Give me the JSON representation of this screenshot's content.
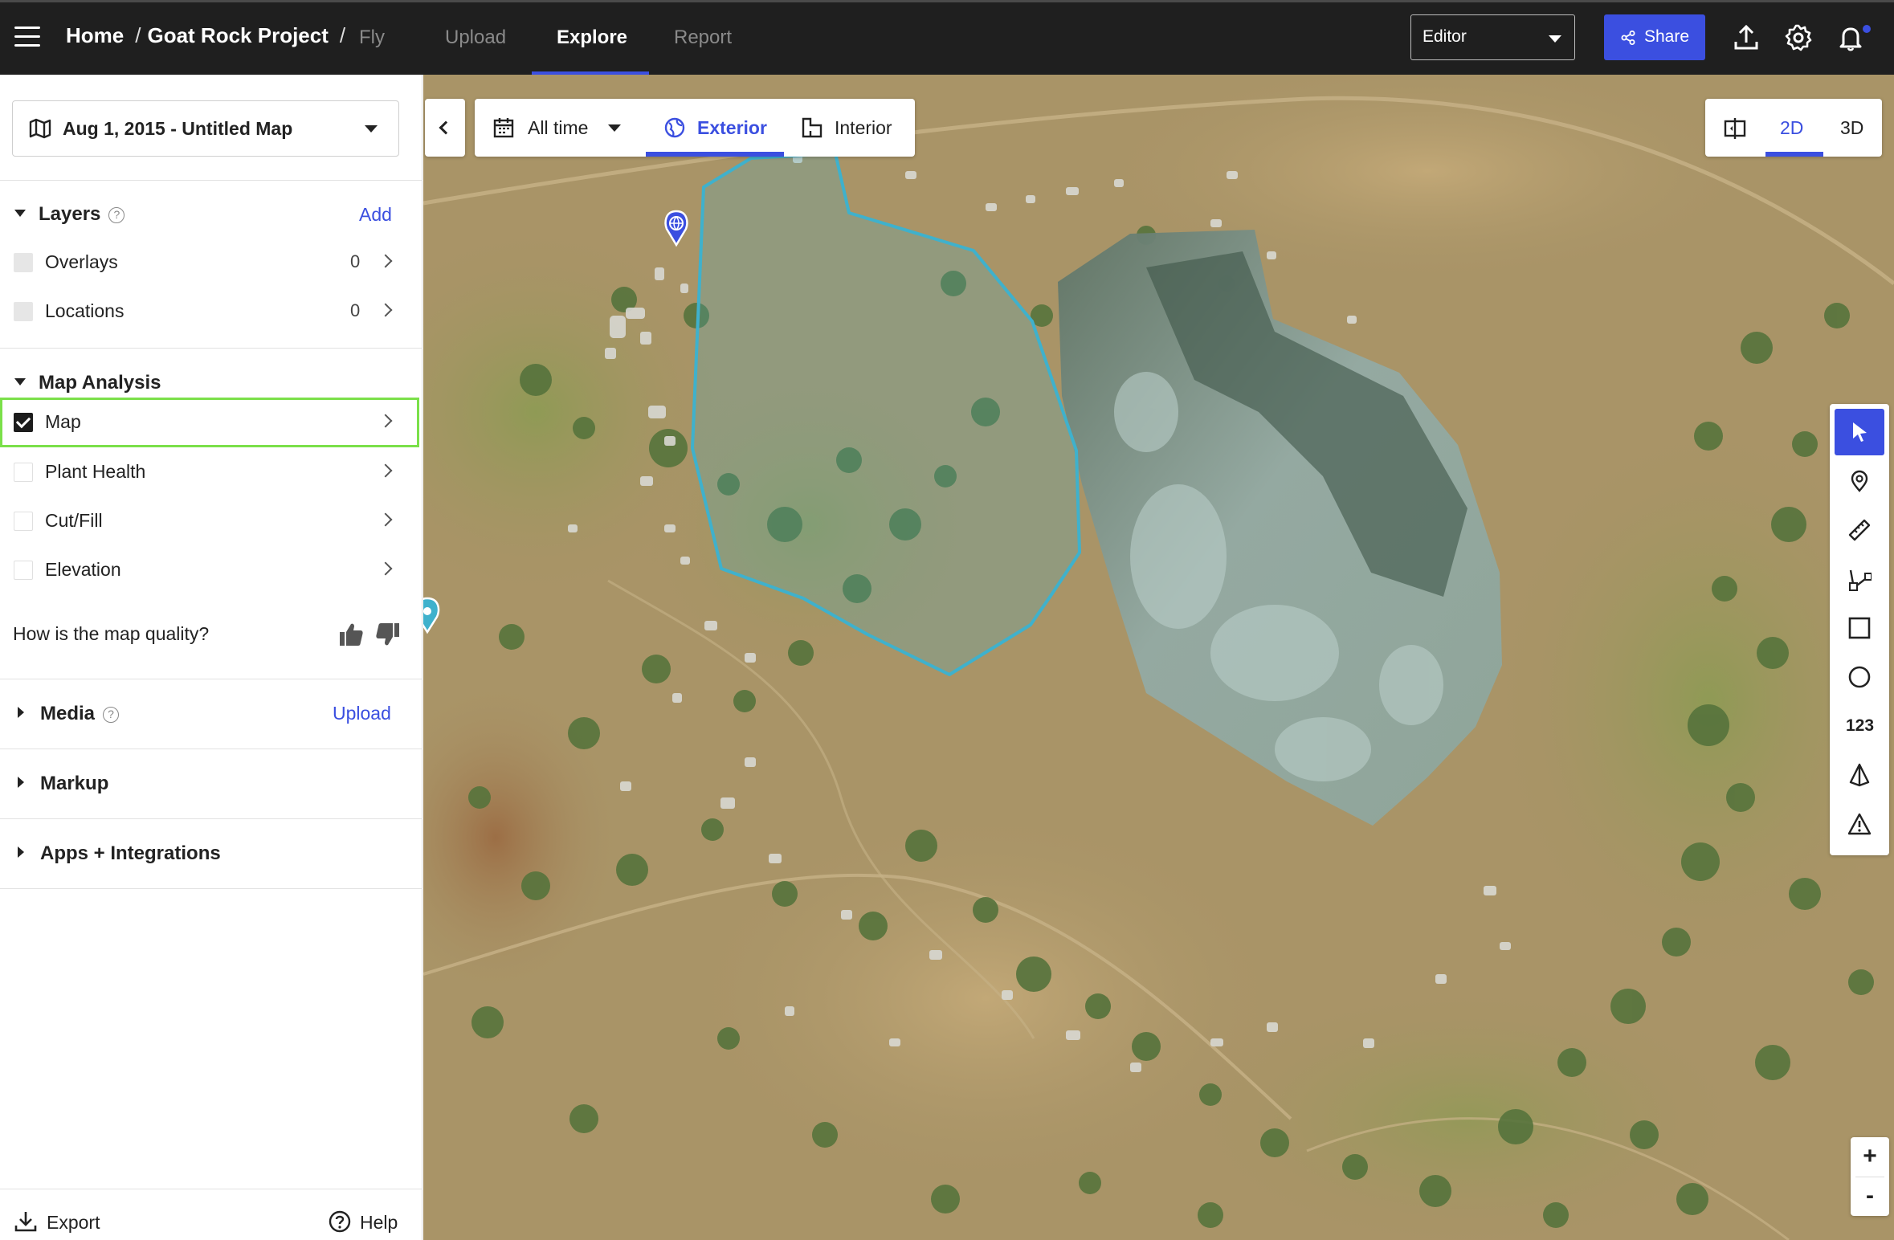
{
  "topbar": {
    "breadcrumb": [
      "Home",
      "Goat Rock Project"
    ],
    "breadcrumb_sep": "/",
    "tabs": [
      "Fly",
      "Upload",
      "Explore",
      "Report"
    ],
    "active_tab": "Explore",
    "role": "Editor",
    "share_label": "Share",
    "accent": "#3b4fe0"
  },
  "sidebar": {
    "map_select": "Aug 1, 2015 - Untitled Map",
    "layers": {
      "title": "Layers",
      "add_label": "Add",
      "items": [
        {
          "label": "Overlays",
          "count": "0"
        },
        {
          "label": "Locations",
          "count": "0"
        }
      ]
    },
    "map_analysis": {
      "title": "Map Analysis",
      "items": [
        {
          "label": "Map",
          "checked": true
        },
        {
          "label": "Plant Health",
          "checked": false
        },
        {
          "label": "Cut/Fill",
          "checked": false
        },
        {
          "label": "Elevation",
          "checked": false
        }
      ]
    },
    "quality_question": "How is the map quality?",
    "media": {
      "title": "Media",
      "upload_label": "Upload"
    },
    "markup": {
      "title": "Markup"
    },
    "apps": {
      "title": "Apps + Integrations"
    },
    "footer": {
      "export": "Export",
      "help": "Help"
    }
  },
  "map": {
    "time_filter": "All time",
    "view_tabs": [
      "Exterior",
      "Interior"
    ],
    "active_view": "Exterior",
    "dimensions": [
      "2D",
      "3D"
    ],
    "active_dimension": "2D",
    "tools": [
      "select-tool",
      "location-pin-tool",
      "measure-distance-tool",
      "polyline-tool",
      "rectangle-tool",
      "circle-tool",
      "count-tool",
      "volume-tool",
      "issue-tool"
    ],
    "count_tool_label": "123",
    "zoom_in": "+",
    "zoom_out": "-",
    "polygon_color": "#3fb1cc"
  }
}
